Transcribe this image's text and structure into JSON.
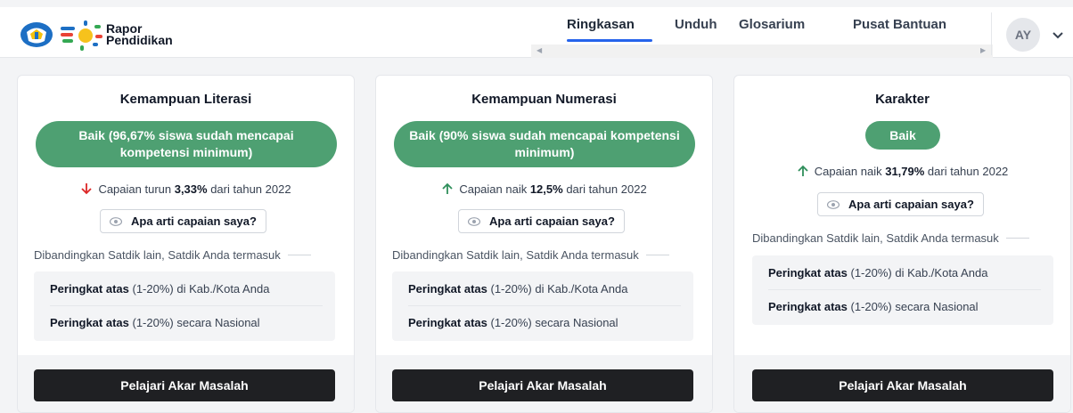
{
  "header": {
    "brand_line1": "Rapor",
    "brand_line2": "Pendidikan",
    "nav": [
      {
        "label": "Ringkasan",
        "active": true
      },
      {
        "label": "Unduh",
        "active": false
      },
      {
        "label": "Glosarium",
        "active": false
      },
      {
        "label": "Pusat Bantuan",
        "active": false
      }
    ],
    "avatar_initials": "AY"
  },
  "cards": [
    {
      "title": "Kemampuan Literasi",
      "badge": "Baik (96,67% siswa sudah mencapai kompetensi minimum)",
      "trend_direction": "down",
      "trend_prefix": "Capaian turun ",
      "trend_value": "3,33%",
      "trend_suffix": " dari tahun 2022",
      "help_label": "Apa arti capaian saya?",
      "compare_label": "Dibandingkan Satdik lain, Satdik Anda termasuk",
      "ranks": [
        {
          "bold": "Peringkat atas",
          "rest": " (1-20%) di Kab./Kota Anda"
        },
        {
          "bold": "Peringkat atas",
          "rest": " (1-20%) secara Nasional"
        }
      ],
      "cta": "Pelajari Akar Masalah"
    },
    {
      "title": "Kemampuan Numerasi",
      "badge": "Baik (90% siswa sudah mencapai kompetensi minimum)",
      "trend_direction": "up",
      "trend_prefix": "Capaian naik ",
      "trend_value": "12,5%",
      "trend_suffix": " dari tahun 2022",
      "help_label": "Apa arti capaian saya?",
      "compare_label": "Dibandingkan Satdik lain, Satdik Anda termasuk",
      "ranks": [
        {
          "bold": "Peringkat atas",
          "rest": " (1-20%) di Kab./Kota Anda"
        },
        {
          "bold": "Peringkat atas",
          "rest": " (1-20%) secara Nasional"
        }
      ],
      "cta": "Pelajari Akar Masalah"
    },
    {
      "title": "Karakter",
      "badge": "Baik",
      "trend_direction": "up",
      "trend_prefix": "Capaian naik ",
      "trend_value": "31,79%",
      "trend_suffix": " dari tahun 2022",
      "help_label": "Apa arti capaian saya?",
      "compare_label": "Dibandingkan Satdik lain, Satdik Anda termasuk",
      "ranks": [
        {
          "bold": "Peringkat atas",
          "rest": " (1-20%) di Kab./Kota Anda"
        },
        {
          "bold": "Peringkat atas",
          "rest": " (1-20%) secara Nasional"
        }
      ],
      "cta": "Pelajari Akar Masalah"
    }
  ],
  "colors": {
    "badge_green": "#4ea072",
    "trend_up": "#2f8f5b",
    "trend_down": "#dc2626",
    "nav_active": "#2563eb",
    "cta_bg": "#1f2023"
  },
  "icons": [
    "kemdikbud-logo-icon",
    "rapor-sun-logo-icon",
    "chevron-down-icon",
    "arrow-down-icon",
    "arrow-up-icon",
    "eye-icon"
  ]
}
